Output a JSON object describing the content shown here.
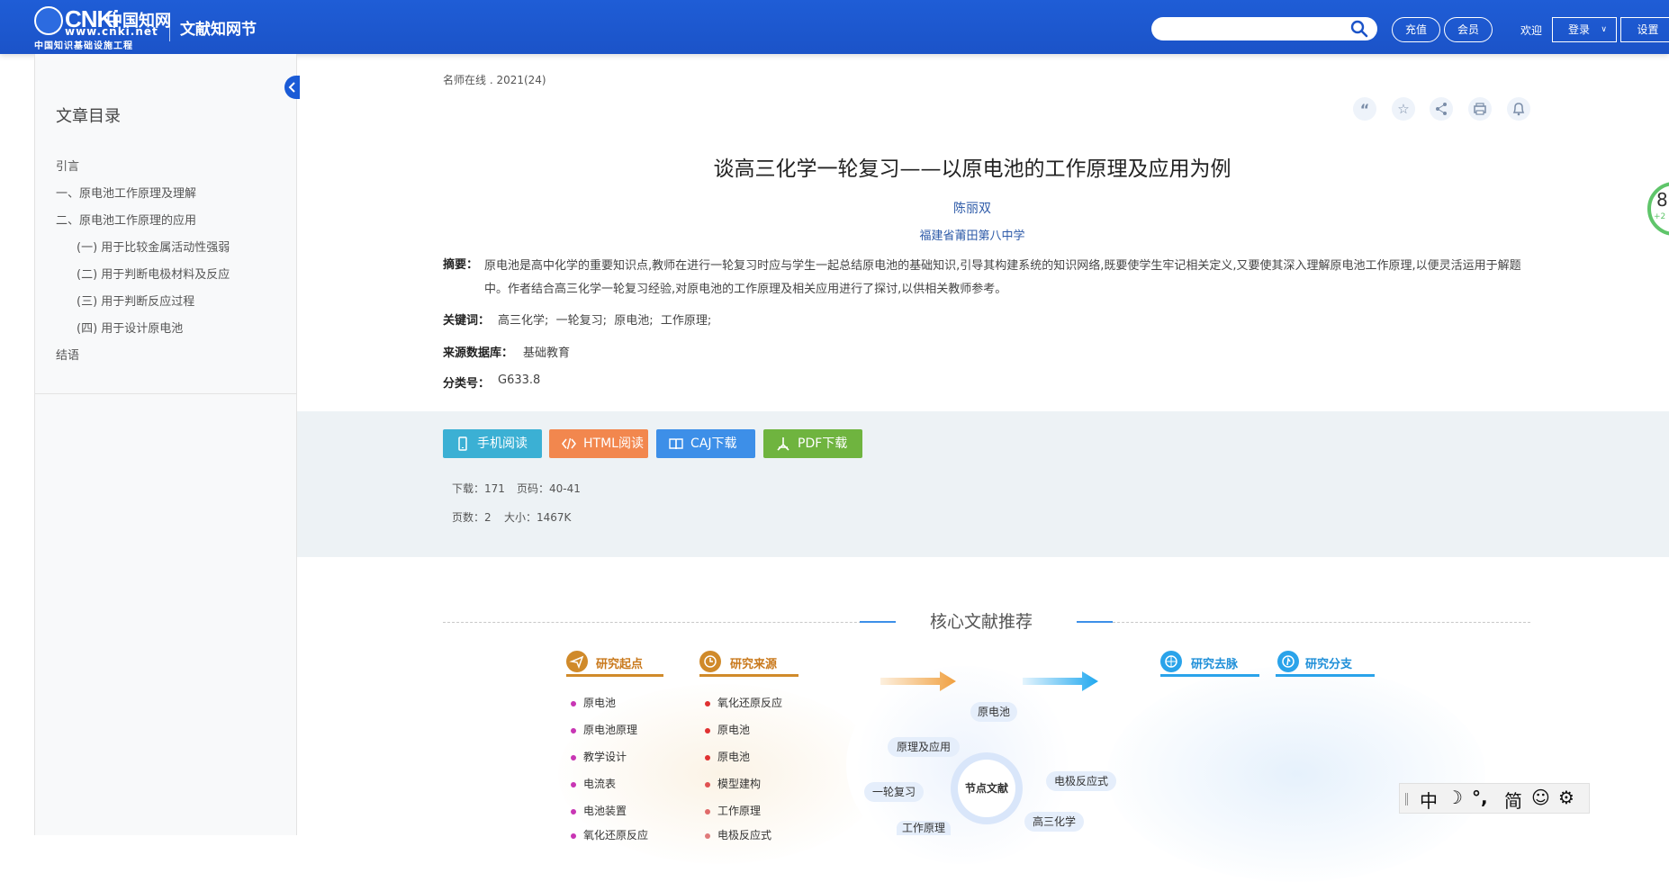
{
  "header": {
    "logo_text": "CNKi",
    "logo_cn": "中国知网",
    "logo_url": "www.cnki.net",
    "logo_sub": "中国知识基础设施工程",
    "site_name": "文献知网节",
    "search_placeholder": "",
    "recharge": "充值",
    "member": "会员",
    "welcome": "欢迎",
    "login": "登录",
    "settings": "设置"
  },
  "sidebar": {
    "title": "文章目录",
    "items": [
      {
        "label": "引言"
      },
      {
        "label": "一、原电池工作原理及理解"
      },
      {
        "label": "二、原电池工作原理的应用"
      },
      {
        "label": "(一) 用于比较金属活动性强弱"
      },
      {
        "label": "(二) 用于判断电极材料及反应"
      },
      {
        "label": "(三) 用于判断反应过程"
      },
      {
        "label": "(四) 用于设计原电池"
      },
      {
        "label": "结语"
      }
    ]
  },
  "article": {
    "source": "名师在线 . 2021(24)",
    "title": "谈高三化学一轮复习——以原电池的工作原理及应用为例",
    "author": "陈丽双",
    "org": "福建省莆田第八中学",
    "abstract_label": "摘要：",
    "abstract": "原电池是高中化学的重要知识点,教师在进行一轮复习时应与学生一起总结原电池的基础知识,引导其构建系统的知识网络,既要使学生牢记相关定义,又要使其深入理解原电池工作原理,以便灵活运用于解题中。作者结合高三化学一轮复习经验,对原电池的工作原理及相关应用进行了探讨,以供相关教师参考。",
    "keywords_label": "关键词：",
    "keywords": "高三化学;  一轮复习;  原电池;  工作原理;",
    "db_label": "来源数据库：",
    "db": "基础教育",
    "class_label": "分类号：",
    "class": "G633.8",
    "score_partial": "8",
    "score_sub": "+2"
  },
  "actions": {
    "mobile": "手机阅读",
    "html": "HTML阅读",
    "caj": "CAJ下载",
    "pdf": "PDF下载",
    "download_stat": "下载：171",
    "pages_stat": "页码：40-41",
    "page_count": "页数：2",
    "size": "大小：1467K",
    "colors": {
      "mobile": "#3bb0d4",
      "html": "#f2874e",
      "caj": "#3d8fe8",
      "pdf": "#6fb43f"
    }
  },
  "recommend": {
    "title": "核心文献推荐",
    "tabs": {
      "start": "研究起点",
      "source": "研究来源",
      "going": "研究去脉",
      "branch": "研究分支"
    },
    "start_items": [
      "原电池",
      "原电池原理",
      "教学设计",
      "电流表",
      "电池装置",
      "氧化还原反应"
    ],
    "source_items": [
      "氧化还原反应",
      "原电池",
      "原电池",
      "模型建构",
      "工作原理",
      "电极反应式"
    ],
    "node": "节点文献",
    "bubbles": [
      "原电池",
      "原理及应用",
      "一轮复习",
      "电极反应式",
      "高三化学",
      "工作原理"
    ]
  },
  "ime": {
    "zh": "中",
    "punct": "°,",
    "simp": "简"
  }
}
